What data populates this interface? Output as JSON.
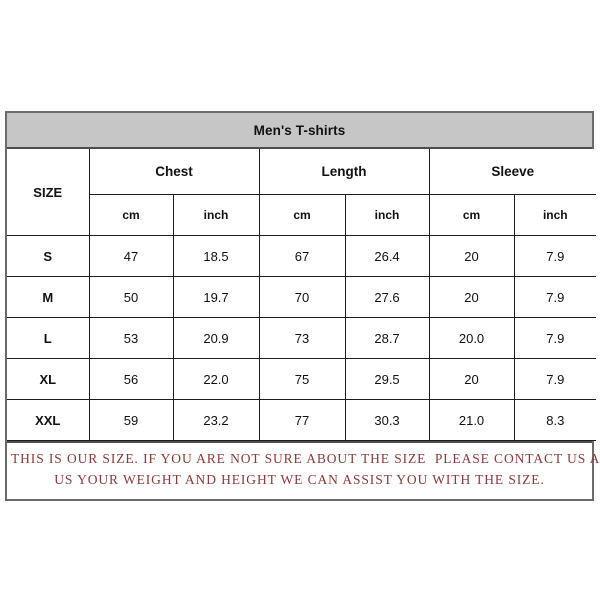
{
  "chart": {
    "title": "Men's T-shirts",
    "size_header": "SIZE",
    "groups": [
      {
        "label": "Chest"
      },
      {
        "label": "Length"
      },
      {
        "label": "Sleeve"
      }
    ],
    "units": [
      "cm",
      "inch",
      "cm",
      "inch",
      "cm",
      "inch"
    ],
    "rows": [
      {
        "size": "S",
        "chest_cm": "47",
        "chest_inch": "18.5",
        "length_cm": "67",
        "length_inch": "26.4",
        "sleeve_cm": "20",
        "sleeve_inch": "7.9"
      },
      {
        "size": "M",
        "chest_cm": "50",
        "chest_inch": "19.7",
        "length_cm": "70",
        "length_inch": "27.6",
        "sleeve_cm": "20",
        "sleeve_inch": "7.9"
      },
      {
        "size": "L",
        "chest_cm": "53",
        "chest_inch": "20.9",
        "length_cm": "73",
        "length_inch": "28.7",
        "sleeve_cm": "20.0",
        "sleeve_inch": "7.9"
      },
      {
        "size": "XL",
        "chest_cm": "56",
        "chest_inch": "22.0",
        "length_cm": "75",
        "length_inch": "29.5",
        "sleeve_cm": "20",
        "sleeve_inch": "7.9"
      },
      {
        "size": "XXL",
        "chest_cm": "59",
        "chest_inch": "23.2",
        "length_cm": "77",
        "length_inch": "30.3",
        "sleeve_cm": "21.0",
        "sleeve_inch": "8.3"
      }
    ],
    "footer": {
      "line1": "THIS IS OUR SIZE. IF YOU ARE NOT SURE ABOUT THE SIZE  PLEASE CONTACT US AND TELL",
      "line2": "US YOUR WEIGHT AND HEIGHT WE CAN ASSIST YOU WITH THE SIZE."
    },
    "colors": {
      "title_bar_bg": "#c6c6c6",
      "footer_text": "#8b3a3a",
      "grid_line": "#1d1d1d",
      "outer_border": "#6b6b6b"
    }
  }
}
